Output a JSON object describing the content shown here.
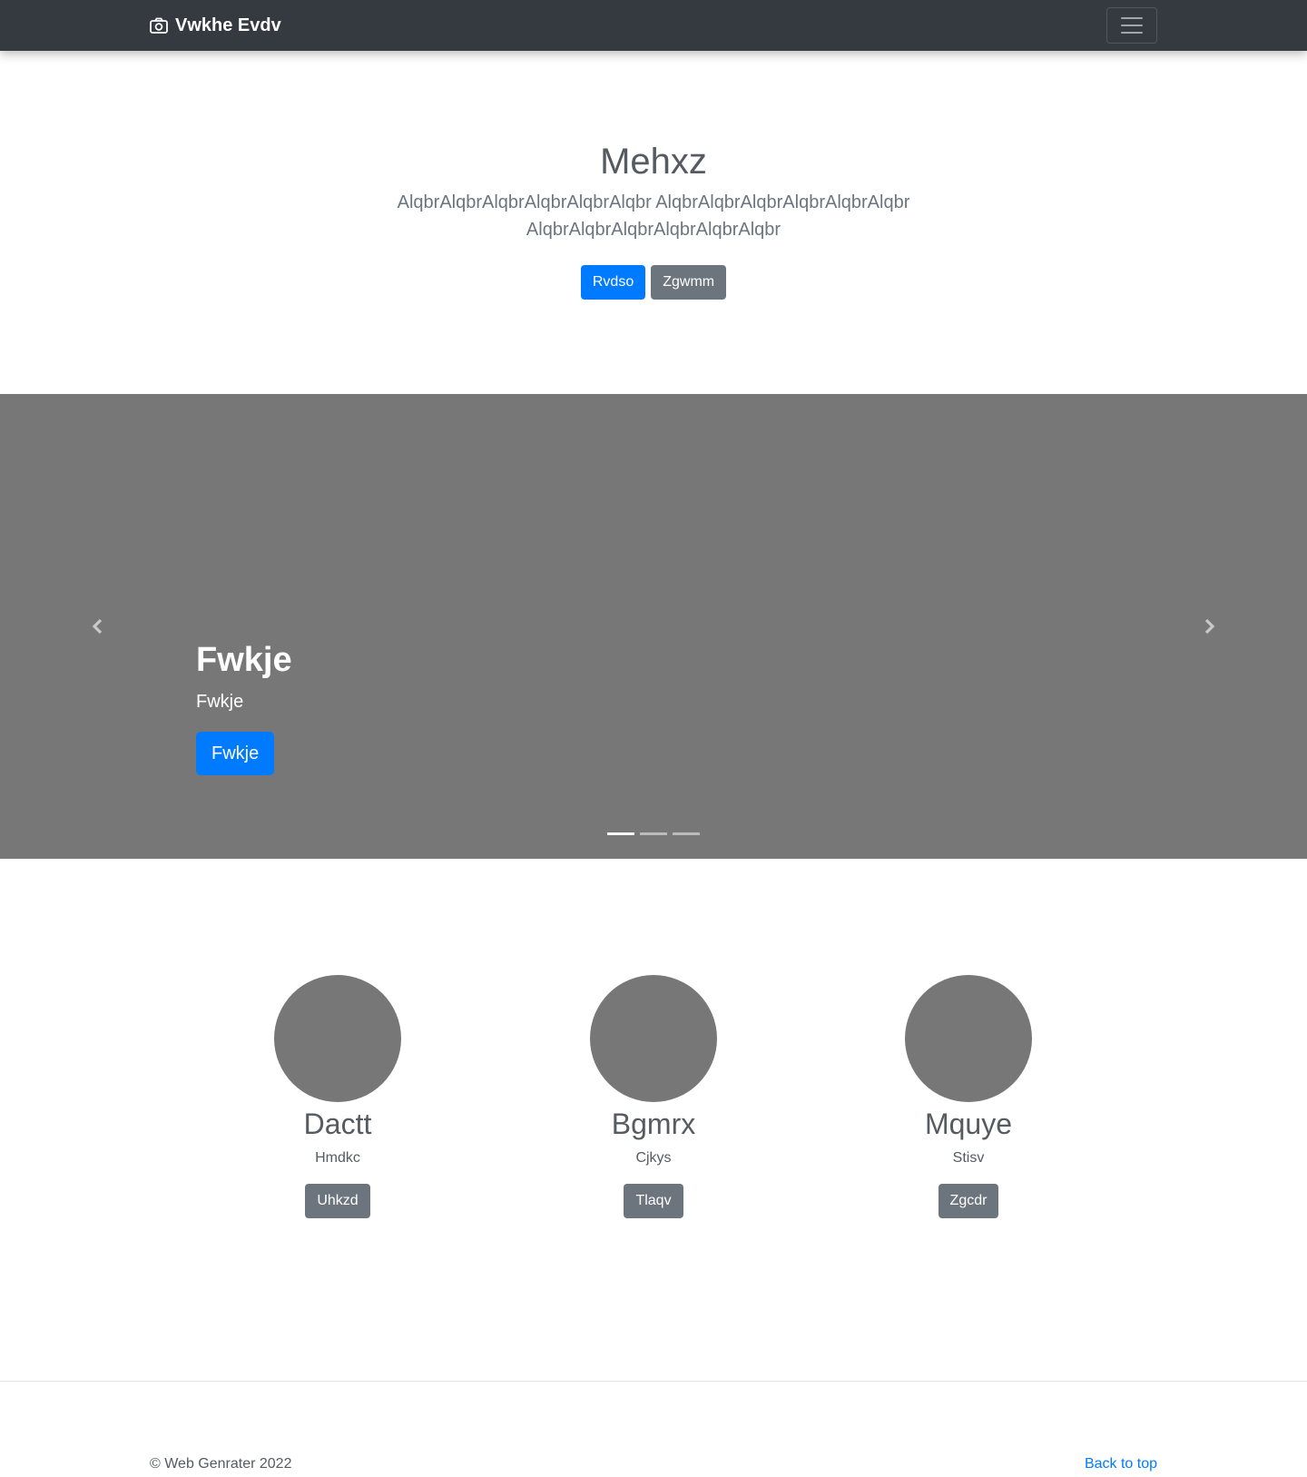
{
  "navbar": {
    "brand": "Vwkhe Evdv",
    "brand_icon": "camera-icon",
    "toggler_icon": "hamburger-menu-icon",
    "background": "#343a40"
  },
  "hero": {
    "title": "Mehxz",
    "lead": "AlqbrAlqbrAlqbrAlqbrAlqbrAlqbr AlqbrAlqbrAlqbrAlqbrAlqbrAlqbr AlqbrAlqbrAlqbrAlqbrAlqbrAlqbr",
    "primary_button": "Rvdso",
    "secondary_button": "Zgwmm"
  },
  "carousel": {
    "background": "#777777",
    "prev_icon": "chevron-left-icon",
    "next_icon": "chevron-right-icon",
    "caption_title": "Fwkje",
    "caption_text": "Fwkje",
    "caption_button": "Fwkje",
    "slide_count": 3,
    "active_slide": 1
  },
  "features": [
    {
      "title": "Dactt",
      "text": "Hmdkc",
      "button": "Uhkzd"
    },
    {
      "title": "Bgmrx",
      "text": "Cjkys",
      "button": "Tlaqv"
    },
    {
      "title": "Mquye",
      "text": "Stisv",
      "button": "Zgcdr"
    }
  ],
  "footer": {
    "copyright": "© Web Genrater 2022",
    "back_to_top": "Back to top"
  },
  "colors": {
    "primary": "#007bff",
    "secondary": "#6c757d",
    "placeholder": "#777777"
  }
}
